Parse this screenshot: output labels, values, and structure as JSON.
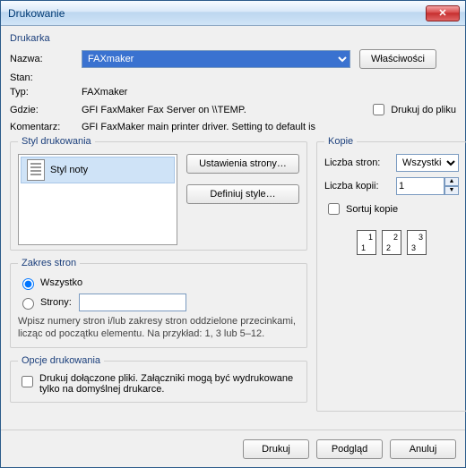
{
  "window": {
    "title": "Drukowanie"
  },
  "printer": {
    "section": "Drukarka",
    "name_label": "Nazwa:",
    "name_value": "FAXmaker",
    "properties_btn": "Właściwości",
    "status_label": "Stan:",
    "status_value": "",
    "type_label": "Typ:",
    "type_value": "FAXmaker",
    "where_label": "Gdzie:",
    "where_value": "GFI FaxMaker Fax Server on \\\\TEMP.",
    "comment_label": "Komentarz:",
    "comment_value": "GFI FaxMaker main printer driver. Setting to default is",
    "print_to_file": "Drukuj do pliku"
  },
  "style": {
    "legend": "Styl drukowania",
    "item": "Styl noty",
    "page_setup_btn": "Ustawienia strony…",
    "define_btn": "Definiuj style…"
  },
  "copies": {
    "legend": "Kopie",
    "pages_label": "Liczba stron:",
    "pages_value": "Wszystkie",
    "count_label": "Liczba kopii:",
    "count_value": "1",
    "collate_label": "Sortuj kopie",
    "icons": [
      "1",
      "1",
      "2",
      "2",
      "3",
      "3"
    ]
  },
  "range": {
    "legend": "Zakres stron",
    "all": "Wszystko",
    "pages": "Strony:",
    "hint": "Wpisz numery stron i/lub zakresy stron oddzielone przecinkami, licząc od początku elementu. Na przykład: 1, 3 lub 5–12."
  },
  "options": {
    "legend": "Opcje drukowania",
    "attach": "Drukuj dołączone pliki. Załączniki mogą być wydrukowane tylko na domyślnej drukarce."
  },
  "footer": {
    "print": "Drukuj",
    "preview": "Podgląd",
    "cancel": "Anuluj"
  }
}
